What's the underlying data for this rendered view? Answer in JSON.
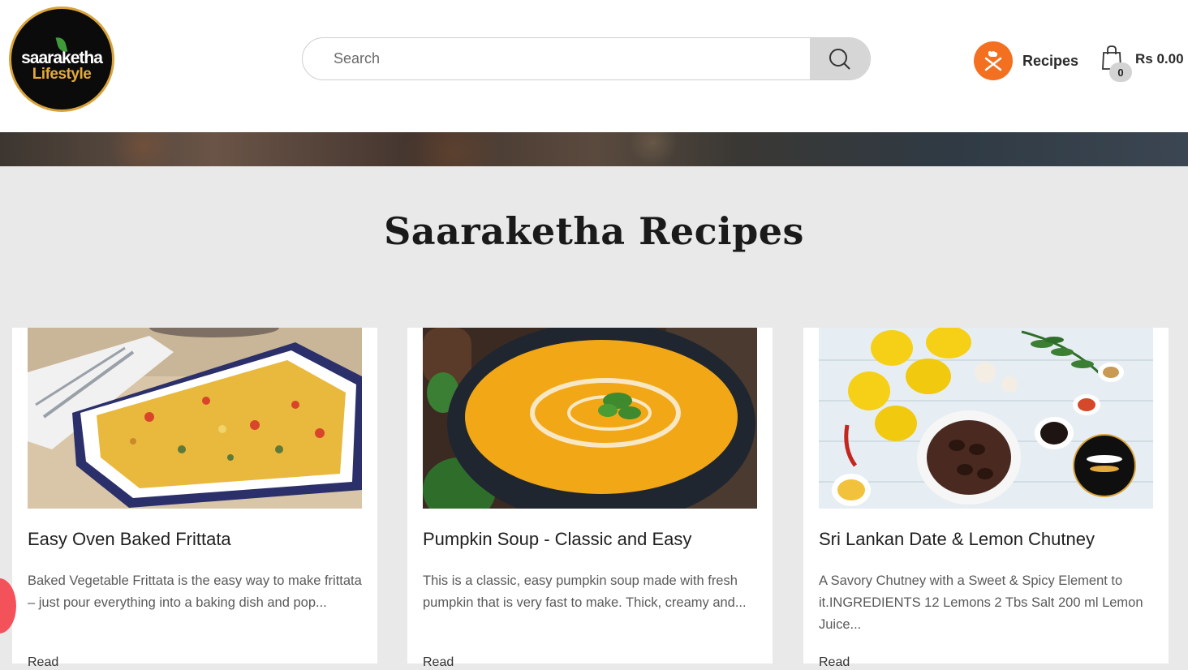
{
  "brand": {
    "logo_line1": "saaraketha",
    "logo_line2": "Lifestyle"
  },
  "search": {
    "placeholder": "Search"
  },
  "nav": {
    "recipes_label": "Recipes"
  },
  "cart": {
    "count": "0",
    "total": "Rs 0.00"
  },
  "page": {
    "title": "Saaraketha Recipes"
  },
  "recipes": [
    {
      "title": "Easy Oven Baked Frittata",
      "excerpt": "Baked Vegetable Frittata is the easy way to make frittata – just pour everything into a baking dish and pop...",
      "more": "Read"
    },
    {
      "title": "Pumpkin Soup - Classic and Easy",
      "excerpt": "This is a classic, easy pumpkin soup made with fresh pumpkin that is very fast to make. Thick, creamy and...",
      "more": "Read"
    },
    {
      "title": "Sri Lankan Date & Lemon Chutney",
      "excerpt": "A Savory Chutney with a Sweet & Spicy Element to it.INGREDIENTS 12 Lemons 2 Tbs Salt 200 ml Lemon Juice...",
      "more": "Read"
    }
  ],
  "colors": {
    "accent_orange": "#f37021",
    "gold": "#d9a33a",
    "float_red": "#f3525a"
  }
}
